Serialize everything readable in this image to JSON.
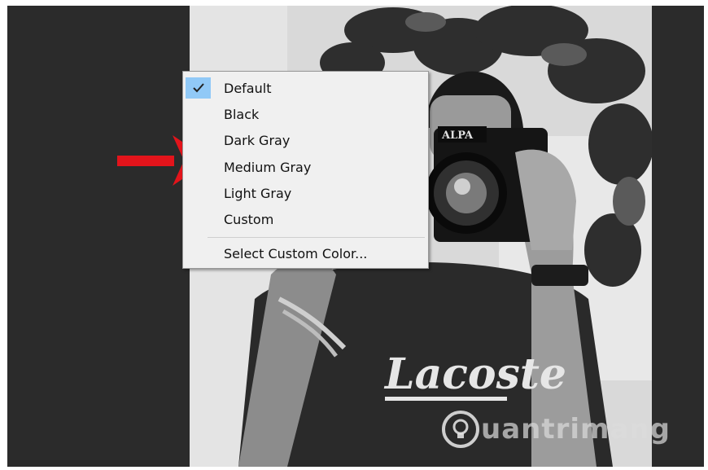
{
  "menu": {
    "items": [
      {
        "label": "Default",
        "checked": true
      },
      {
        "label": "Black",
        "checked": false
      },
      {
        "label": "Dark Gray",
        "checked": false
      },
      {
        "label": "Medium Gray",
        "checked": false
      },
      {
        "label": "Light Gray",
        "checked": false
      },
      {
        "label": "Custom",
        "checked": false
      }
    ],
    "custom_color_label": "Select Custom Color...",
    "check_color": "#91c9f7"
  },
  "photo": {
    "camera_brand": "ALPA",
    "shirt_text": "Lacoste"
  },
  "watermark": {
    "text": "uantrimang"
  },
  "colors": {
    "canvas_background": "#2b2b2b",
    "arrow": "#e3141b",
    "menu_background": "#f0f0f0"
  }
}
